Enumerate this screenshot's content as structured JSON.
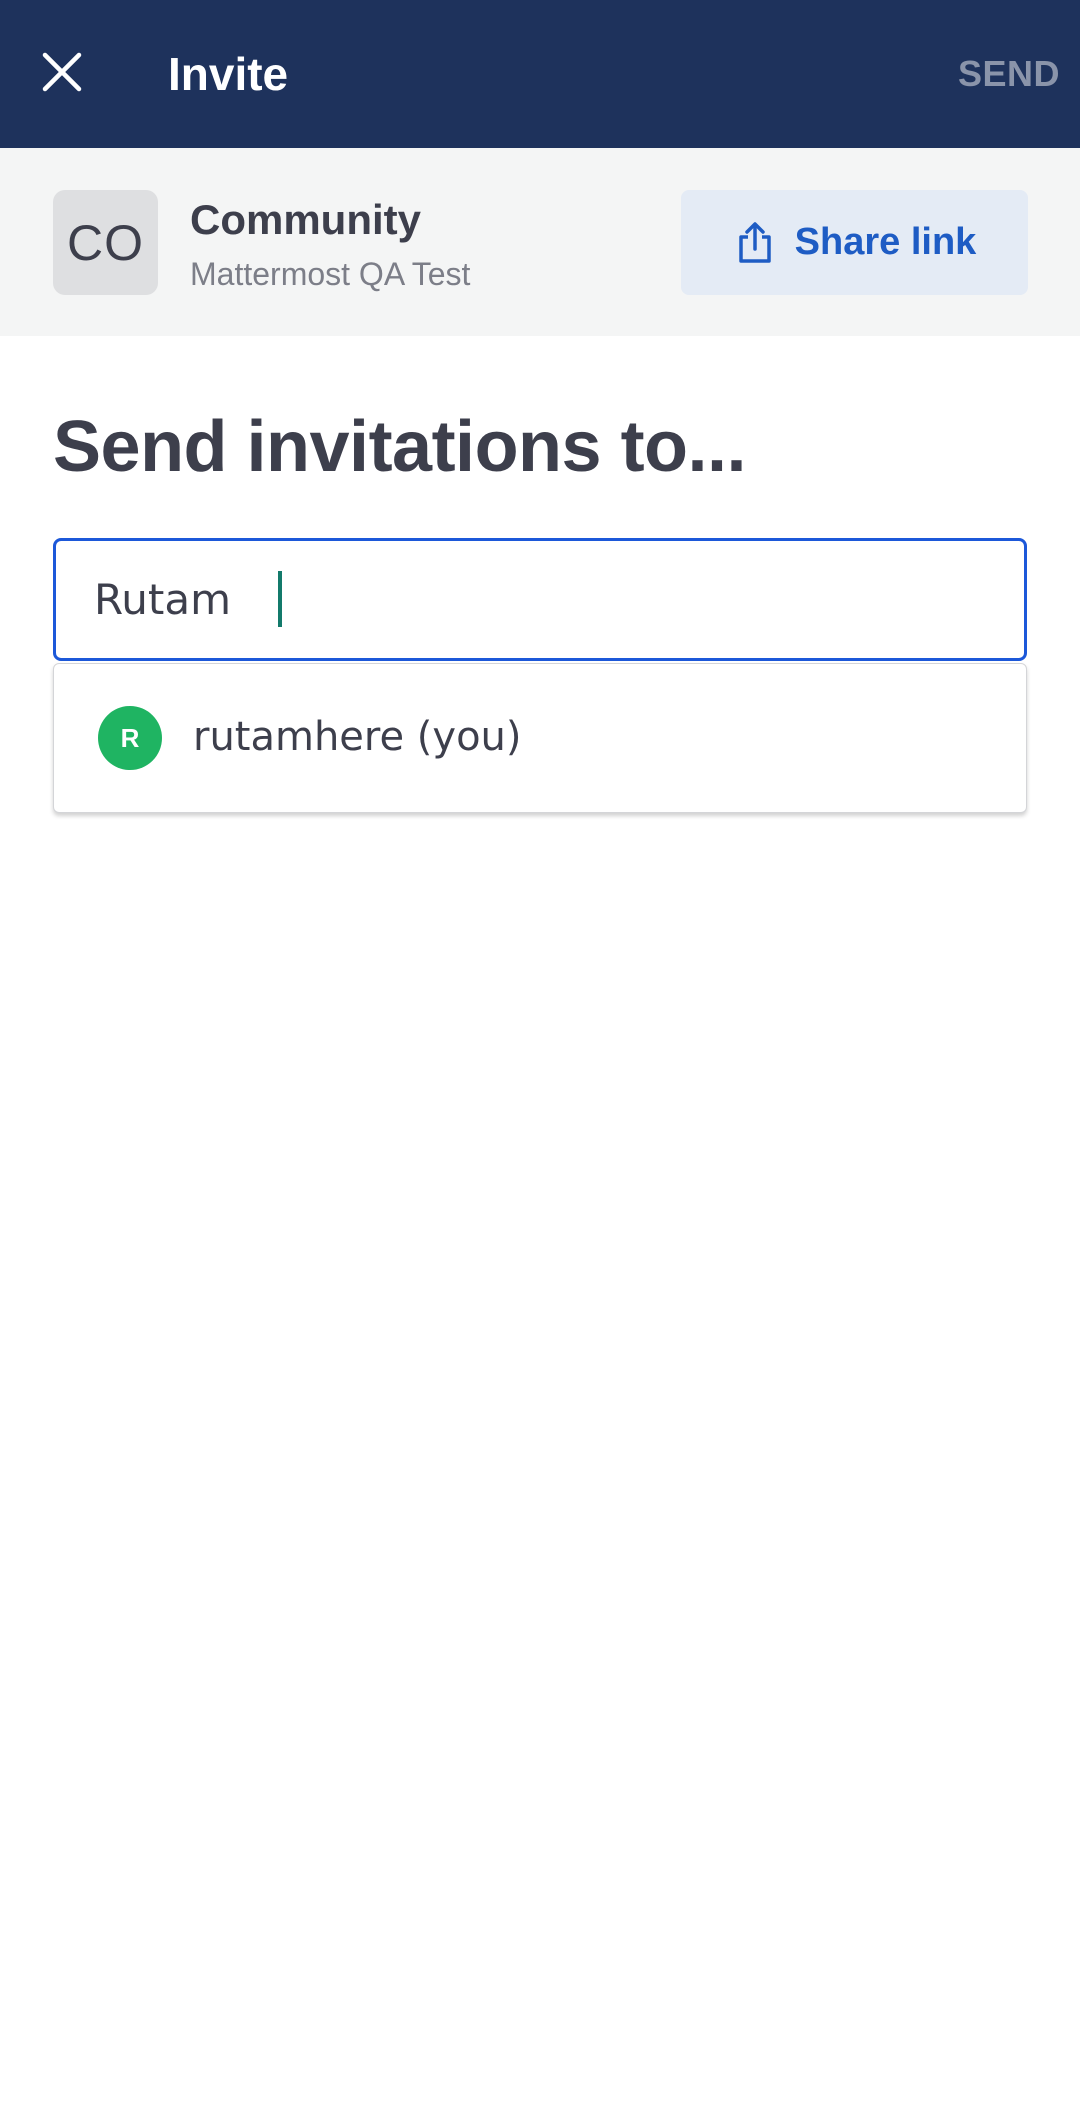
{
  "header": {
    "title": "Invite",
    "send_label": "SEND",
    "close_icon": "close-icon",
    "background_color": "#1e325c"
  },
  "team": {
    "avatar_initials": "CO",
    "name": "Community",
    "subtitle": "Mattermost QA Test",
    "share_button_label": "Share link",
    "share_icon": "share-icon"
  },
  "main": {
    "heading": "Send invitations to..."
  },
  "search": {
    "value": "Rutam",
    "accent_color": "#1c58d9"
  },
  "suggestions": [
    {
      "avatar_initial": "R",
      "label": "rutamhere (you)",
      "avatar_color": "#1fb462"
    }
  ]
}
